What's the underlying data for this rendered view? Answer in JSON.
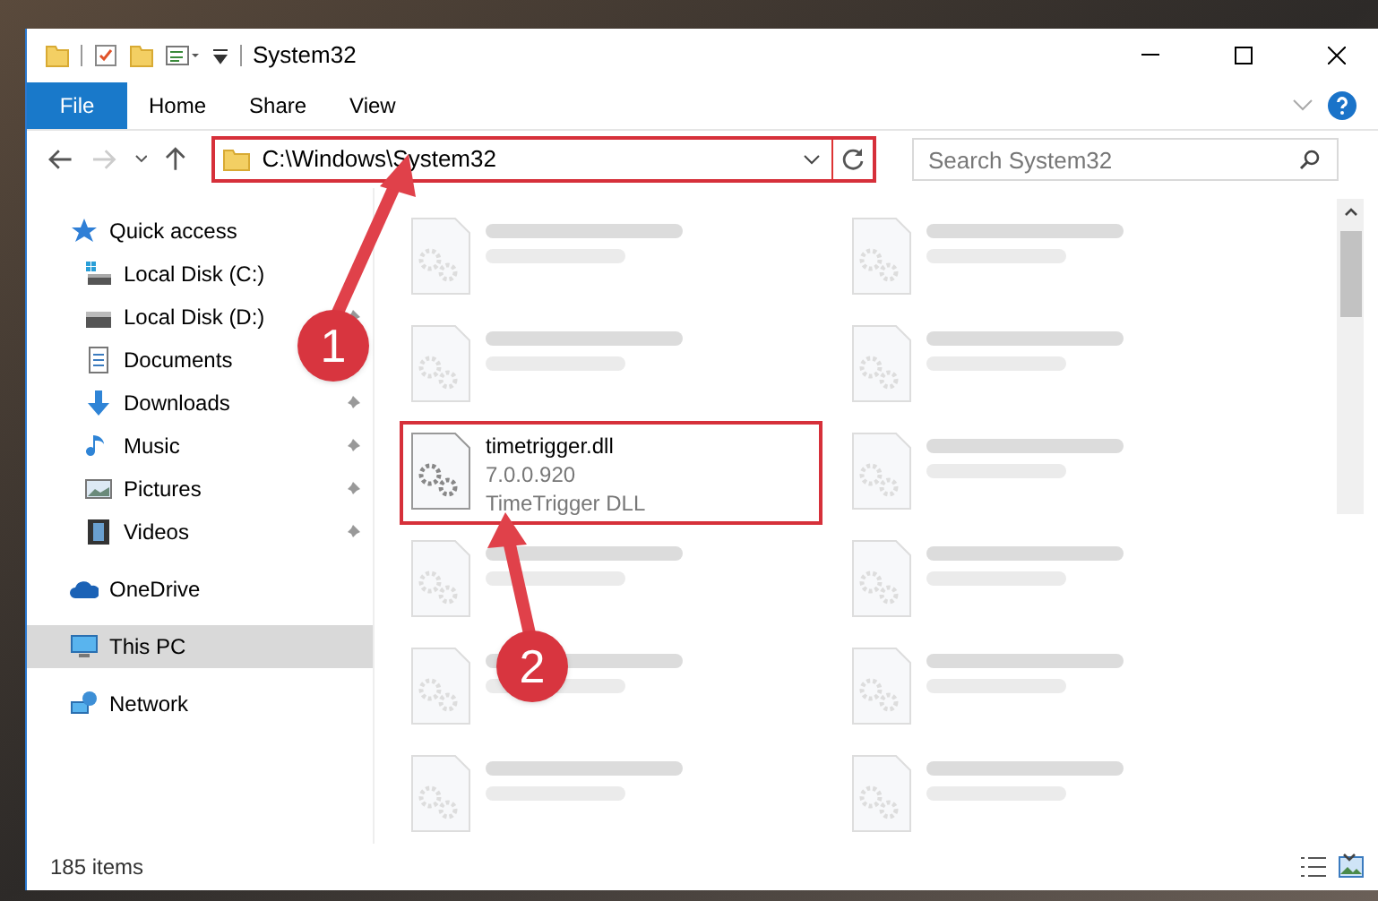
{
  "window": {
    "title": "System32"
  },
  "ribbon_tabs": [
    {
      "label": "File",
      "selected": true
    },
    {
      "label": "Home",
      "selected": false
    },
    {
      "label": "Share",
      "selected": false
    },
    {
      "label": "View",
      "selected": false
    }
  ],
  "address_bar": {
    "path": "C:\\Windows\\System32",
    "highlighted": true
  },
  "search": {
    "placeholder": "Search System32"
  },
  "nav": [
    {
      "label": "Quick access",
      "kind": "star",
      "selected": false
    },
    {
      "label": "Local Disk (C:)",
      "kind": "systemdrive",
      "selected": false
    },
    {
      "label": "Local Disk (D:)",
      "kind": "drive",
      "pinned": true,
      "selected": false
    },
    {
      "label": "Documents",
      "kind": "documents",
      "selected": false
    },
    {
      "label": "Downloads",
      "kind": "downloads",
      "pinned": true,
      "selected": false
    },
    {
      "label": "Music",
      "kind": "music",
      "pinned": true,
      "selected": false
    },
    {
      "label": "Pictures",
      "kind": "pictures",
      "pinned": true,
      "selected": false
    },
    {
      "label": "Videos",
      "kind": "videos",
      "pinned": true,
      "selected": false
    },
    {
      "label": "OneDrive",
      "kind": "cloud",
      "selected": false
    },
    {
      "label": "This PC",
      "kind": "pc",
      "selected": true
    },
    {
      "label": "Network",
      "kind": "network",
      "selected": false
    }
  ],
  "files": [
    {
      "kind": "blurred",
      "highlighted": false
    },
    {
      "kind": "blurred",
      "highlighted": false
    },
    {
      "kind": "blurred",
      "highlighted": false
    },
    {
      "kind": "blurred",
      "highlighted": false
    },
    {
      "kind": "file",
      "name": "timetrigger.dll",
      "lines": [
        "7.0.0.920",
        "TimeTrigger DLL"
      ],
      "highlighted": true
    },
    {
      "kind": "blurred",
      "highlighted": false
    },
    {
      "kind": "blurred",
      "highlighted": false
    },
    {
      "kind": "blurred",
      "highlighted": false
    },
    {
      "kind": "blurred",
      "highlighted": false
    },
    {
      "kind": "blurred",
      "highlighted": false
    },
    {
      "kind": "blurred",
      "highlighted": false
    },
    {
      "kind": "blurred",
      "highlighted": false
    }
  ],
  "status_bar": {
    "count": "185 items"
  },
  "callouts": [
    {
      "label": "1"
    },
    {
      "label": "2"
    }
  ]
}
